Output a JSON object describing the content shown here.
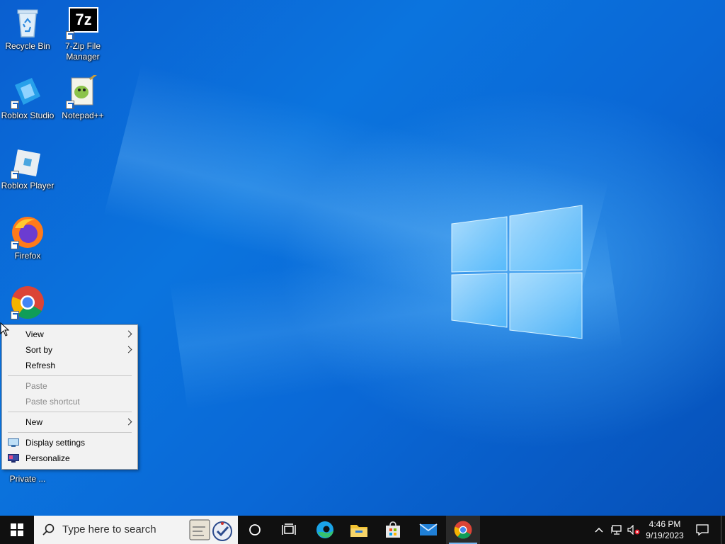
{
  "desktop": {
    "icons": [
      {
        "label": "Recycle Bin",
        "icon": "recycle-bin-icon"
      },
      {
        "label": "7-Zip File Manager",
        "label1": "7-Zip File",
        "label2": "Manager",
        "icon": "7zip-icon",
        "glyph": "7z"
      },
      {
        "label": "Roblox Studio",
        "icon": "roblox-studio-icon"
      },
      {
        "label": "Notepad++",
        "icon": "notepad-plus-plus-icon"
      },
      {
        "label": "Roblox Player",
        "icon": "roblox-player-icon"
      },
      {
        "label": "Firefox",
        "icon": "firefox-icon"
      },
      {
        "label": "",
        "icon": "chrome-icon"
      },
      {
        "label1": "Private ...",
        "icon": "private-browser-icon"
      }
    ]
  },
  "context_menu": {
    "items": [
      {
        "label": "View",
        "has_submenu": true,
        "enabled": true
      },
      {
        "label": "Sort by",
        "has_submenu": true,
        "enabled": true
      },
      {
        "label": "Refresh",
        "has_submenu": false,
        "enabled": true
      },
      {
        "label": "Paste",
        "has_submenu": false,
        "enabled": false
      },
      {
        "label": "Paste shortcut",
        "has_submenu": false,
        "enabled": false
      },
      {
        "label": "New",
        "has_submenu": true,
        "enabled": true
      },
      {
        "label": "Display settings",
        "icon": "display-settings-icon",
        "enabled": true
      },
      {
        "label": "Personalize",
        "icon": "personalize-icon",
        "enabled": true
      }
    ]
  },
  "taskbar": {
    "search_placeholder": "Type here to search",
    "pinned": [
      "cortana-icon",
      "task-view-icon",
      "edge-icon",
      "file-explorer-icon",
      "store-icon",
      "mail-icon",
      "chrome-icon"
    ],
    "time": "4:46 PM",
    "date": "9/19/2023"
  },
  "colors": {
    "wallpaper": "#0a6ad6",
    "taskbar": "#101010",
    "menu_bg": "#f2f2f2",
    "disabled_text": "#8a8a8a"
  }
}
